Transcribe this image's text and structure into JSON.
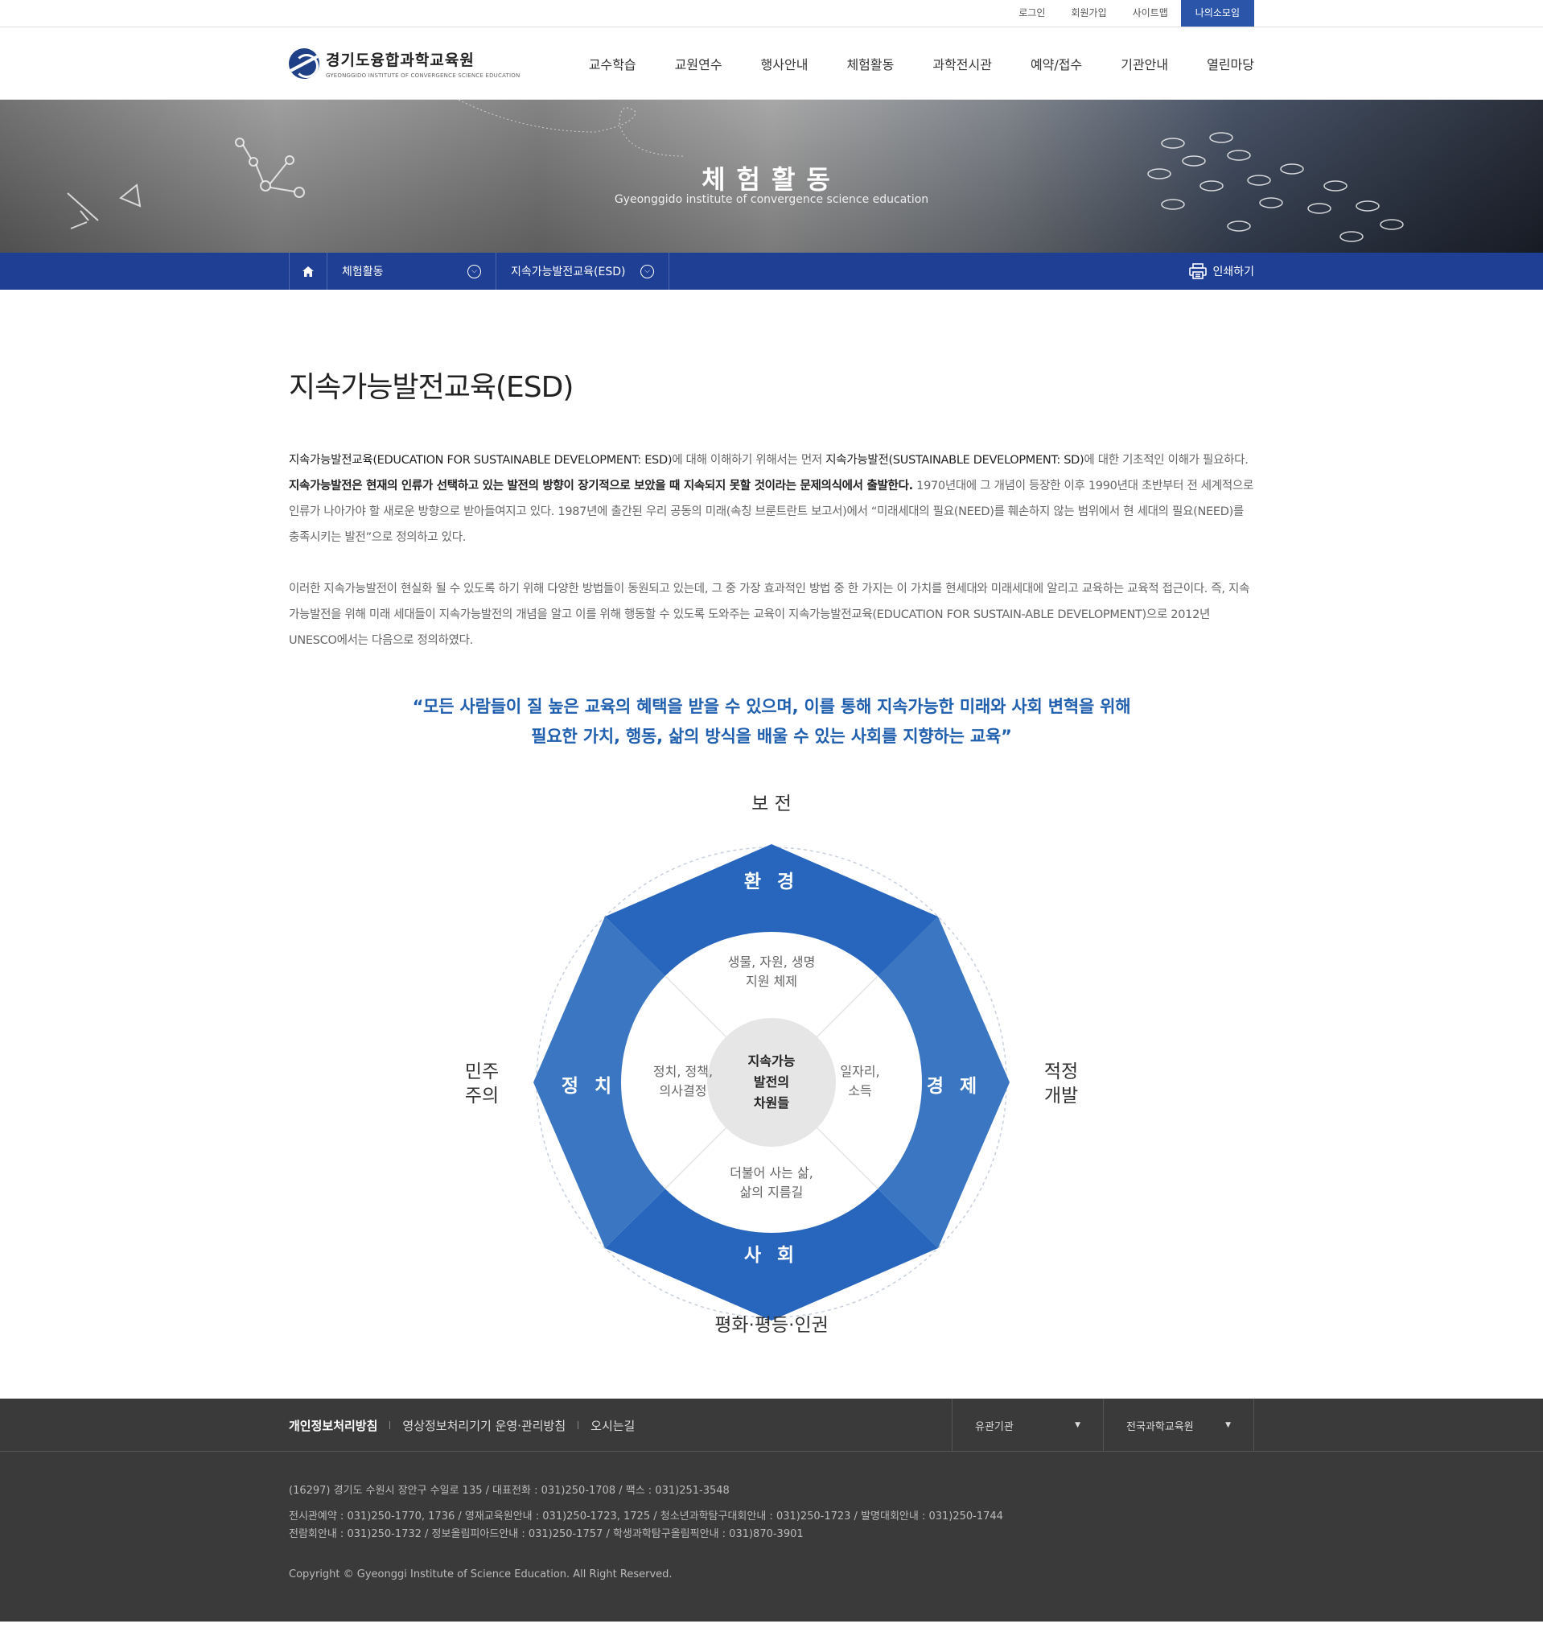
{
  "util": {
    "login": "로그인",
    "join": "회원가입",
    "sitemap": "사이트맵",
    "mine": "나의소모임"
  },
  "logo": {
    "name_kr": "경기도융합과학교육원",
    "name_en": "GYEONGGIDO INSTITUTE OF CONVERGENCE SCIENCE EDUCATION"
  },
  "gnb": [
    "교수학습",
    "교원연수",
    "행사안내",
    "체험활동",
    "과학전시관",
    "예약/접수",
    "기관안내",
    "열린마당"
  ],
  "visual": {
    "title": "체험활동",
    "subtitle": "Gyeonggido institute of convergence science education"
  },
  "location": {
    "depth1": "체험활동",
    "depth2": "지속가능발전교육(ESD)",
    "print": "인쇄하기"
  },
  "page": {
    "title": "지속가능발전교육(ESD)",
    "p1": {
      "a": "지속가능발전교육(EDUCATION FOR SUSTAINABLE DEVELOPMENT: ESD)",
      "b": "에 대해 이해하기 위해서는 먼저 ",
      "c": "지속가능발전(SUSTAINABLE DEVELOPMENT: SD)",
      "d": "에 대한 기초적인 이해가 필요하다. ",
      "e": "지속가능발전은 현재의 인류가 선택하고 있는 발전의 방향이 장기적으로 보았을 때 지속되지 못할 것이라는 문제의식에서 출발한다.",
      "f": " 1970년대에 그 개념이 등장한 이후 1990년대 초반부터 전 세계적으로 인류가 나아가야 할 새로운 방향으로 받아들여지고 있다. 1987년에 출간된 우리 공동의 미래(속칭 브룬트란트 보고서)에서 “미래세대의 필요(NEED)를 훼손하지 않는 범위에서 현 세대의 필요(NEED)를 충족시키는 발전”으로 정의하고 있다."
    },
    "p2": "이러한 지속가능발전이 현실화 될 수 있도록 하기 위해 다양한 방법들이 동원되고 있는데, 그 중 가장 효과적인 방법 중 한 가지는 이 가치를 현세대와 미래세대에 알리고 교육하는 교육적 접근이다. 즉, 지속가능발전을 위해 미래 세대들이 지속가능발전의 개념을 알고 이를 위해 행동할 수 있도록 도와주는 교육이 지속가능발전교육(EDUCATION FOR SUSTAIN-ABLE DEVELOPMENT)으로 2012년 UNESCO에서는 다음으로 정의하였다.",
    "quote1": "“모든 사람들이 질 높은 교육의 혜택을 받을 수 있으며, 이를 통해 지속가능한 미래와 사회 변혁을 위해",
    "quote2": "필요한 가치, 행동, 삶의 방식을 배울 수 있는 사회를 지향하는 교육”"
  },
  "diagram": {
    "top_outer": "보 전",
    "bottom_outer": "평화·평등·인권",
    "left_outer_1": "민주",
    "left_outer_2": "주의",
    "right_outer_1": "적정",
    "right_outer_2": "개발",
    "ring_top": "환 경",
    "ring_bottom": "사 회",
    "ring_left": "정 치",
    "ring_right": "경 제",
    "inner_top_1": "생물, 자원, 생명",
    "inner_top_2": "지원 체제",
    "inner_left_1": "정치, 정책,",
    "inner_left_2": "의사결정",
    "inner_right_1": "일자리,",
    "inner_right_2": "소득",
    "inner_bottom_1": "더불어 사는 삶,",
    "inner_bottom_2": "삶의 지름길",
    "center_1": "지속가능",
    "center_2": "발전의",
    "center_3": "차원들",
    "colors": {
      "dark_blue": "#2766bc",
      "mid_blue": "#3a76c2",
      "light_blue": "#6a9bd6",
      "center_gray": "#e6e6e6"
    }
  },
  "footer": {
    "links": [
      "개인정보처리방침",
      "영상정보처리기기 운영·관리방침",
      "오시는길"
    ],
    "select1": "유관기관",
    "select2": "전국과학교육원",
    "address": "(16297) 경기도 수원시 장안구 수일로 135 / 대표전화 : 031)250-1708 / 팩스 : 031)251-3548",
    "contact1": "전시관예약 : 031)250-1770, 1736 / 영재교육원안내 : 031)250-1723, 1725 / 청소년과학탐구대회안내 : 031)250-1723 / 발명대회안내 : 031)250-1744",
    "contact2": "전람회안내 : 031)250-1732 / 정보올림피아드안내 : 031)250-1757 / 학생과학탐구올림픽안내 : 031)870-3901",
    "copyright": "Copyright © Gyeonggi Institute of Science Education. All Right Reserved."
  }
}
